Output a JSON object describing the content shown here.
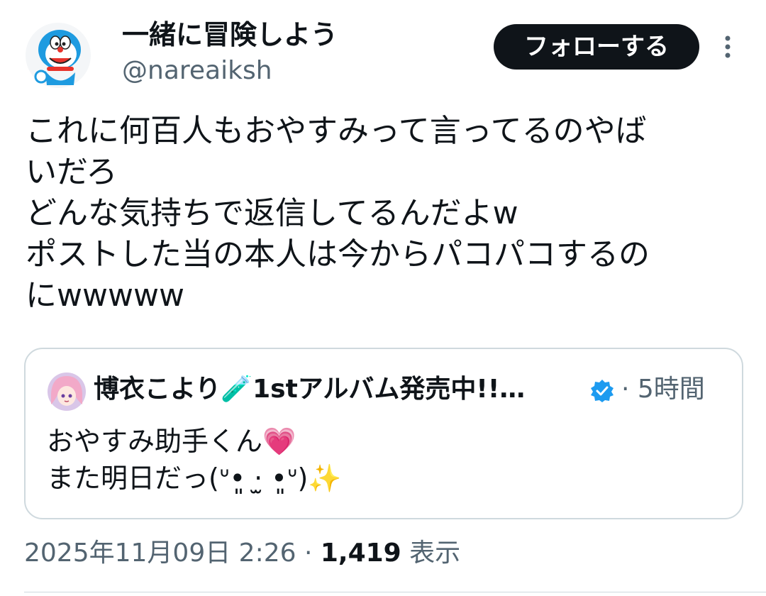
{
  "author": {
    "display_name": "一緒に冒険しよう",
    "handle": "@nareaiksh",
    "avatar_icon": "blue-cartoon-cat-avatar-icon"
  },
  "follow_button": {
    "label": "フォローする"
  },
  "more_icon": "vertical-ellipsis-icon",
  "post": {
    "text": "これに何百人もおやすみって言ってるのやば\nいだろ\nどんな気持ちで返信してるんだよw\nポストした当の本人は今からパコパコするの\nにwwwww"
  },
  "quoted_post": {
    "display_name": "博衣こより🧪1stアルバム発売中!!…",
    "verified_icon": "verified-badge-icon",
    "time": "· 5時間",
    "text": "おやすみ助手くん💗\nまた明日だっ(ᐡ•͈ ·̫ •͈ᐡ)✨"
  },
  "meta": {
    "timestamp": "2025年11月09日 2:26 · ",
    "views_count": "1,419",
    "views_label": " 表示"
  },
  "colors": {
    "text_primary": "#0f1419",
    "text_secondary": "#536471",
    "border": "#cfd9de",
    "verified_blue": "#1d9bf0",
    "button_background": "#0f1419"
  }
}
